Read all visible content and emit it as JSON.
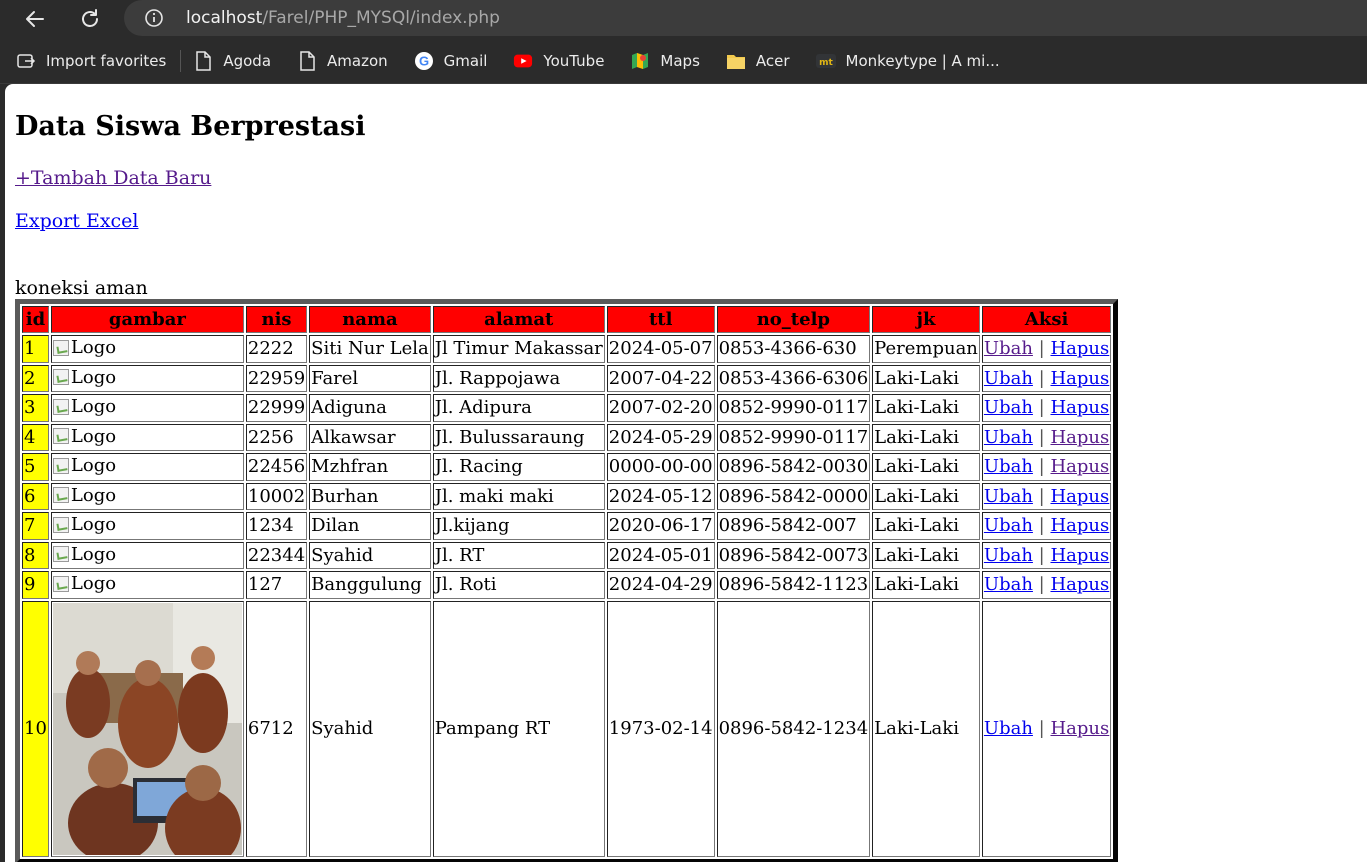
{
  "browser": {
    "url_host": "localhost",
    "url_path": "/Farel/PHP_MYSQl/index.php",
    "bookmarks": [
      {
        "label": "Import favorites",
        "icon": "import-icon"
      },
      {
        "label": "Agoda",
        "icon": "page-icon"
      },
      {
        "label": "Amazon",
        "icon": "page-icon"
      },
      {
        "label": "Gmail",
        "icon": "google-icon"
      },
      {
        "label": "YouTube",
        "icon": "youtube-icon"
      },
      {
        "label": "Maps",
        "icon": "maps-icon"
      },
      {
        "label": "Acer",
        "icon": "folder-icon"
      },
      {
        "label": "Monkeytype | A mi...",
        "icon": "monkeytype-icon"
      }
    ]
  },
  "page": {
    "title": "Data Siswa Berprestasi",
    "add_link": "+Tambah Data Baru",
    "export_link": "Export Excel",
    "status": "koneksi aman",
    "columns": [
      "id",
      "gambar",
      "nis",
      "nama",
      "alamat",
      "ttl",
      "no_telp",
      "jk",
      "Aksi"
    ],
    "image_alt": "Logo",
    "action_edit": "Ubah",
    "action_sep": "|",
    "action_delete": "Hapus",
    "rows": [
      {
        "id": "1",
        "nis": "2222",
        "nama": "Siti Nur Lela",
        "alamat": "Jl Timur Makassar",
        "ttl": "2024-05-07",
        "no_telp": "0853-4366-630",
        "jk": "Perempuan"
      },
      {
        "id": "2",
        "nis": "22959",
        "nama": "Farel",
        "alamat": "Jl. Rappojawa",
        "ttl": "2007-04-22",
        "no_telp": "0853-4366-6306",
        "jk": "Laki-Laki"
      },
      {
        "id": "3",
        "nis": "22999",
        "nama": "Adiguna",
        "alamat": "Jl. Adipura",
        "ttl": "2007-02-20",
        "no_telp": "0852-9990-0117",
        "jk": "Laki-Laki"
      },
      {
        "id": "4",
        "nis": "2256",
        "nama": "Alkawsar",
        "alamat": "Jl. Bulussaraung",
        "ttl": "2024-05-29",
        "no_telp": "0852-9990-0117",
        "jk": "Laki-Laki"
      },
      {
        "id": "5",
        "nis": "22456",
        "nama": "Mzhfran",
        "alamat": "Jl. Racing",
        "ttl": "0000-00-00",
        "no_telp": "0896-5842-0030",
        "jk": "Laki-Laki"
      },
      {
        "id": "6",
        "nis": "10002",
        "nama": "Burhan",
        "alamat": "Jl. maki maki",
        "ttl": "2024-05-12",
        "no_telp": "0896-5842-0000",
        "jk": "Laki-Laki"
      },
      {
        "id": "7",
        "nis": "1234",
        "nama": "Dilan",
        "alamat": "Jl.kijang",
        "ttl": "2020-06-17",
        "no_telp": "0896-5842-007",
        "jk": "Laki-Laki"
      },
      {
        "id": "8",
        "nis": "22344",
        "nama": "Syahid",
        "alamat": "Jl. RT",
        "ttl": "2024-05-01",
        "no_telp": "0896-5842-0073",
        "jk": "Laki-Laki"
      },
      {
        "id": "9",
        "nis": "127",
        "nama": "Banggulung",
        "alamat": "Jl. Roti",
        "ttl": "2024-04-29",
        "no_telp": "0896-5842-1123",
        "jk": "Laki-Laki"
      },
      {
        "id": "10",
        "nis": "6712",
        "nama": "Syahid",
        "alamat": "Pampang RT",
        "ttl": "1973-02-14",
        "no_telp": "0896-5842-1234",
        "jk": "Laki-Laki"
      }
    ]
  },
  "colors": {
    "header_bg": "#ff0000",
    "id_bg": "#ffff00",
    "link": "#0000ee",
    "visited": "#551a8b"
  }
}
